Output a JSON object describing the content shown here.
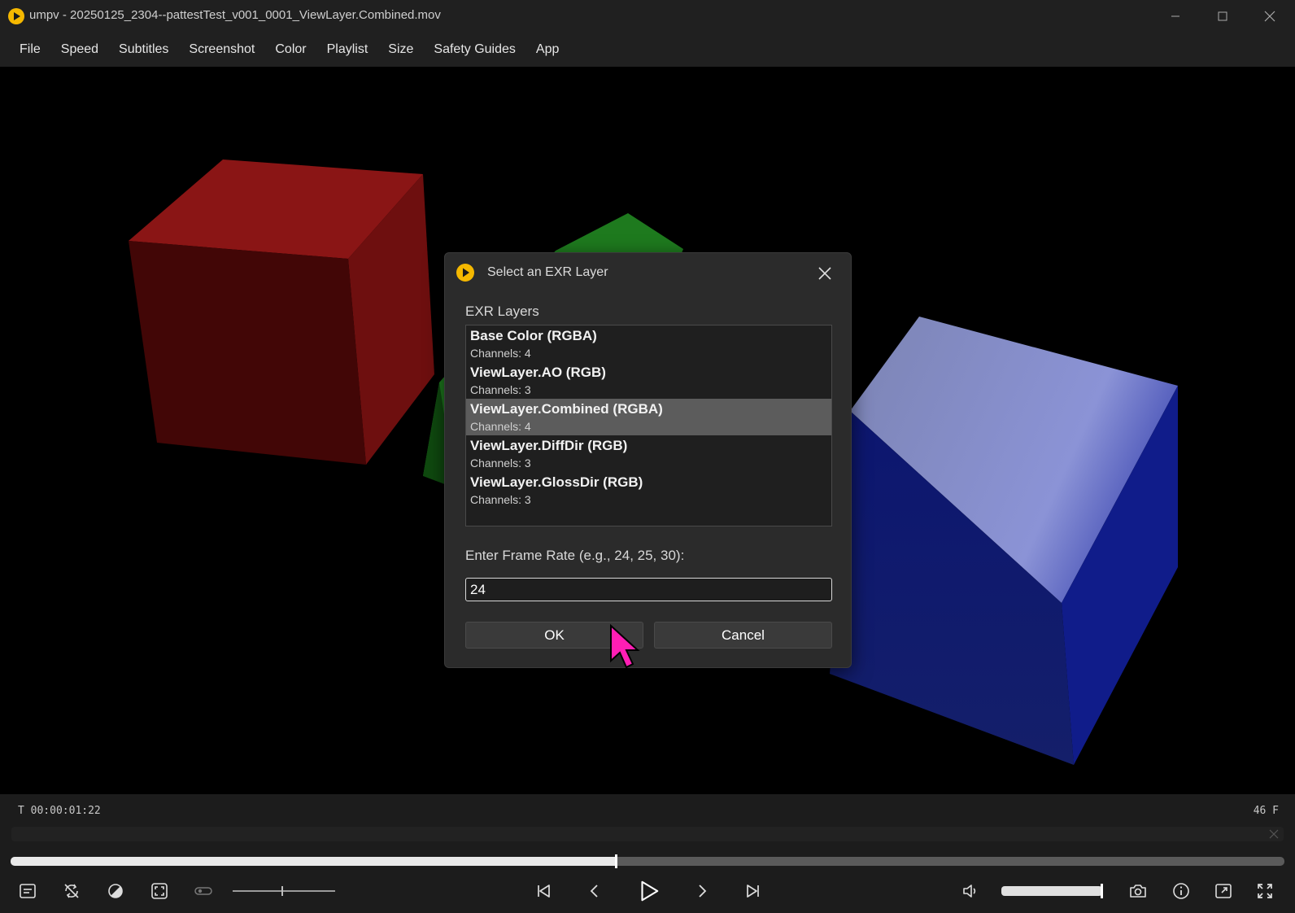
{
  "window": {
    "title": "umpv - 20250125_2304--pattestTest_v001_0001_ViewLayer.Combined.mov",
    "accent_color": "#f5b800"
  },
  "menu": {
    "items": [
      "File",
      "Speed",
      "Subtitles",
      "Screenshot",
      "Color",
      "Playlist",
      "Size",
      "Safety Guides",
      "App"
    ]
  },
  "dialog": {
    "title": "Select an EXR Layer",
    "list_label": "EXR Layers",
    "layers": [
      {
        "name": "Base Color (RGBA)",
        "channels": "Channels: 4",
        "selected": false
      },
      {
        "name": "ViewLayer.AO (RGB)",
        "channels": "Channels: 3",
        "selected": false
      },
      {
        "name": "ViewLayer.Combined (RGBA)",
        "channels": "Channels: 4",
        "selected": true
      },
      {
        "name": "ViewLayer.DiffDir (RGB)",
        "channels": "Channels: 3",
        "selected": false
      },
      {
        "name": "ViewLayer.GlossDir (RGB)",
        "channels": "Channels: 3",
        "selected": false
      }
    ],
    "frame_rate_label": "Enter Frame Rate (e.g., 24, 25, 30):",
    "frame_rate_value": "24",
    "ok_label": "OK",
    "cancel_label": "Cancel"
  },
  "player": {
    "timecode": "T 00:00:01:22",
    "frame_count": "46 F",
    "seek_progress": 0.475,
    "volume_level": 1.0,
    "left_icons": [
      "subtitles-icon",
      "loop-off-icon",
      "color-filter-icon",
      "fit-frame-icon",
      "toggle-icon"
    ],
    "center_icons": [
      "skip-start-icon",
      "prev-frame-icon",
      "play-icon",
      "next-frame-icon",
      "skip-end-icon"
    ],
    "right_icons": [
      "volume-icon",
      "camera-icon",
      "info-icon",
      "picture-in-picture-icon",
      "fullscreen-icon"
    ]
  }
}
